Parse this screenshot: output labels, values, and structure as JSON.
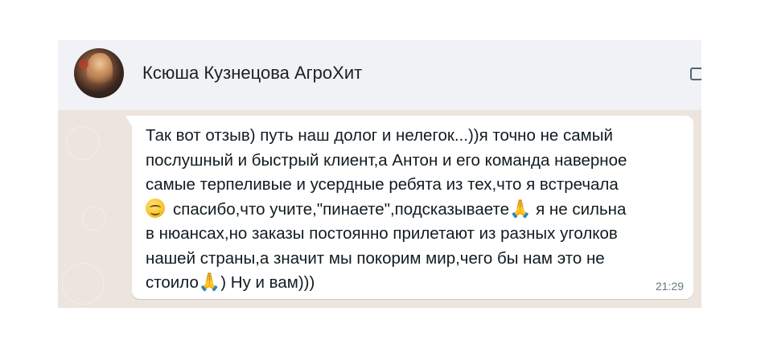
{
  "chat": {
    "contact_name": "Ксюша Кузнецова АгроХит",
    "message": {
      "lines": [
        "Так вот отзыв) путь наш долог и нелегок...))я точно не самый",
        "послушный и быстрый клиент,а Антон и его команда наверное",
        "самые терпеливые и усердные ребята из тех,что я встречала",
        "спасибо,что учите,\"пинаете\",подсказываете",
        "я не сильна",
        "в нюансах,но заказы постоянно прилетают из разных уголков",
        "нашей страны,а значит мы покорим мир,чего бы нам это не",
        "стоило",
        ") Ну и вам)))"
      ],
      "emoji": {
        "smile": "smiling-face-icon",
        "pray": "🙏"
      },
      "time": "21:29"
    }
  },
  "colors": {
    "chat_background": "#ece5dd",
    "header_background": "#f0f2f5",
    "bubble_background": "#ffffff",
    "timestamp": "#667781"
  }
}
